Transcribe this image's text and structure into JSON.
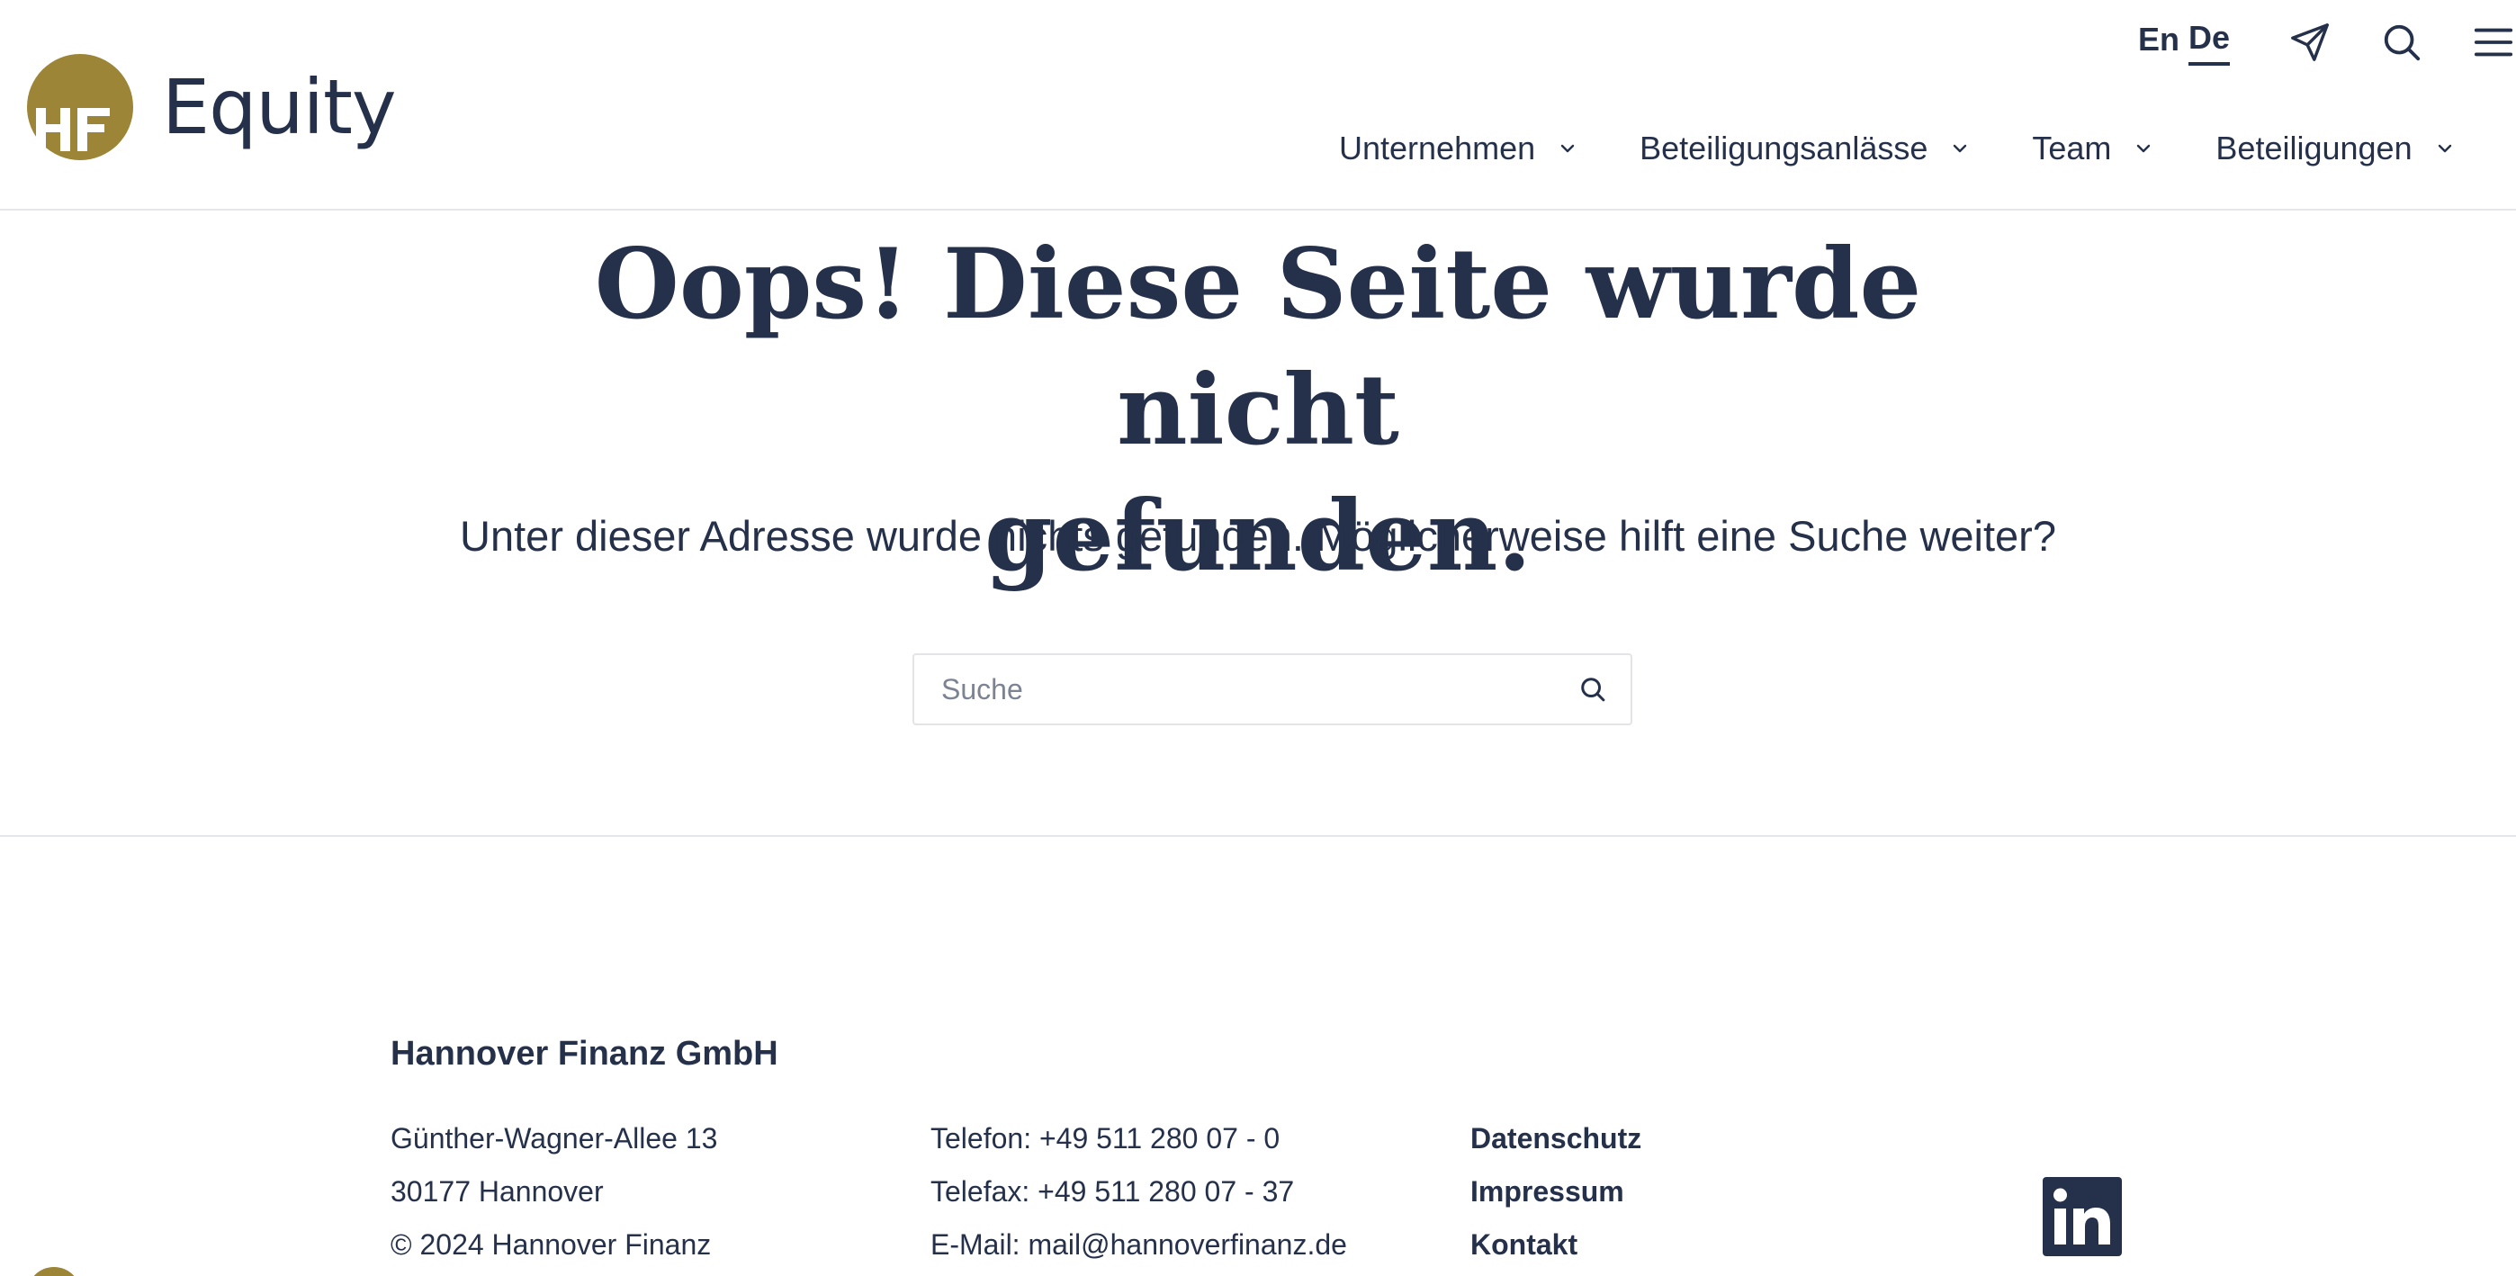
{
  "brand": {
    "name": "Equity",
    "accent_color": "#9c8537",
    "text_color": "#25304a"
  },
  "header": {
    "languages": [
      {
        "label": "En",
        "active": false
      },
      {
        "label": "De",
        "active": true
      }
    ],
    "icons": [
      "paper-plane-icon",
      "search-icon",
      "menu-icon"
    ],
    "nav": [
      {
        "label": "Unternehmen"
      },
      {
        "label": "Beteiligungsanlässe"
      },
      {
        "label": "Team"
      },
      {
        "label": "Beteiligungen"
      }
    ]
  },
  "main": {
    "title_line1": "Oops! Diese Seite wurde nicht",
    "title_line2": "gefunden.",
    "subtitle": "Unter dieser Adresse wurde nichts gefunden. Möglicherweise hilft eine Suche weiter?",
    "search": {
      "placeholder": "Suche",
      "value": ""
    }
  },
  "footer": {
    "company": "Hannover Finanz GmbH",
    "address": [
      "Günther-Wagner-Allee 13",
      "30177 Hannover",
      "© 2024 Hannover Finanz"
    ],
    "contact": [
      "Telefon: +49 511 280 07 - 0",
      "Telefax: +49 511 280 07 - 37",
      "E-Mail: mail@hannoverfinanz.de"
    ],
    "links": [
      "Datenschutz",
      "Impressum",
      "Kontakt"
    ],
    "social": [
      "linkedin-icon"
    ]
  }
}
